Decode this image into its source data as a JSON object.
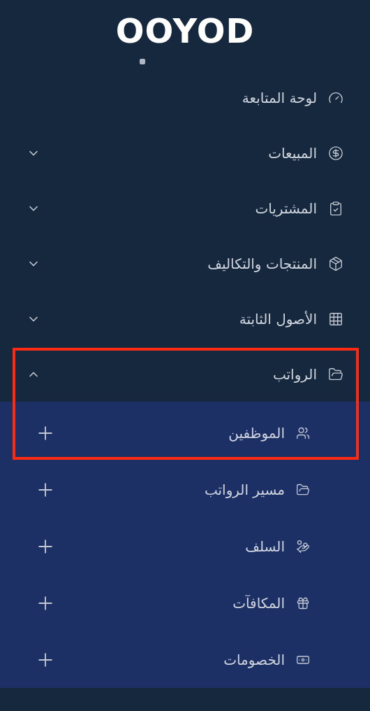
{
  "logo": "OOYOD",
  "menu": [
    {
      "label": "لوحة المتابعة",
      "expandable": false
    },
    {
      "label": "المبيعات",
      "expandable": true,
      "expanded": false
    },
    {
      "label": "المشتريات",
      "expandable": true,
      "expanded": false
    },
    {
      "label": "المنتجات والتكاليف",
      "expandable": true,
      "expanded": false
    },
    {
      "label": "الأصول الثابتة",
      "expandable": true,
      "expanded": false
    },
    {
      "label": "الرواتب",
      "expandable": true,
      "expanded": true,
      "highlighted": true,
      "children": [
        {
          "label": "الموظفين"
        },
        {
          "label": "مسير الرواتب"
        },
        {
          "label": "السلف"
        },
        {
          "label": "المكافآت"
        },
        {
          "label": "الخصومات"
        }
      ]
    }
  ]
}
